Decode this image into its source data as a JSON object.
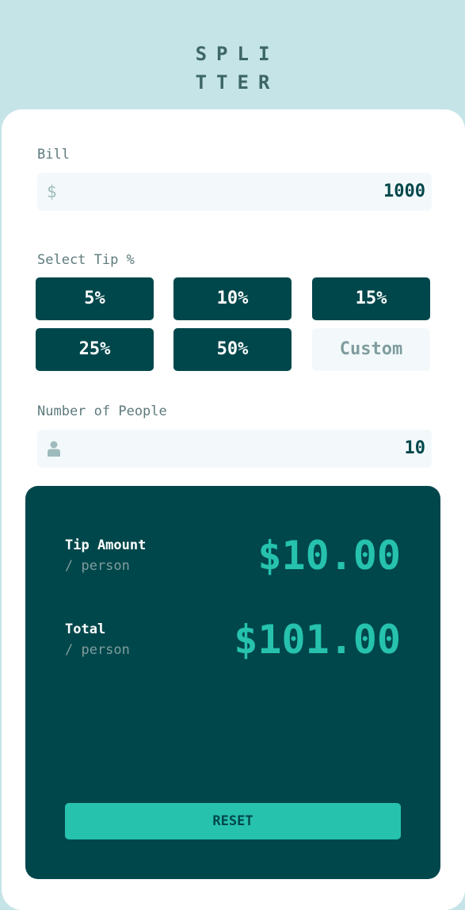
{
  "app": {
    "logo_line1": "SPLI",
    "logo_line2": "TTER"
  },
  "bill": {
    "label": "Bill",
    "prefix": "$",
    "value": "1000"
  },
  "tip": {
    "label": "Select Tip %",
    "options": [
      "5%",
      "10%",
      "15%",
      "25%",
      "50%"
    ],
    "custom_placeholder": "Custom"
  },
  "people": {
    "label": "Number of People",
    "icon": "person-icon",
    "value": "10"
  },
  "results": {
    "tip_label": "Tip Amount",
    "tip_sub": "/ person",
    "tip_value": "$10.00",
    "total_label": "Total",
    "total_sub": "/ person",
    "total_value": "$101.00",
    "reset_label": "RESET"
  },
  "colors": {
    "background": "#c5e4e7",
    "primary": "#00474b",
    "accent": "#26c2ae",
    "input_bg": "#f3f9fa"
  }
}
